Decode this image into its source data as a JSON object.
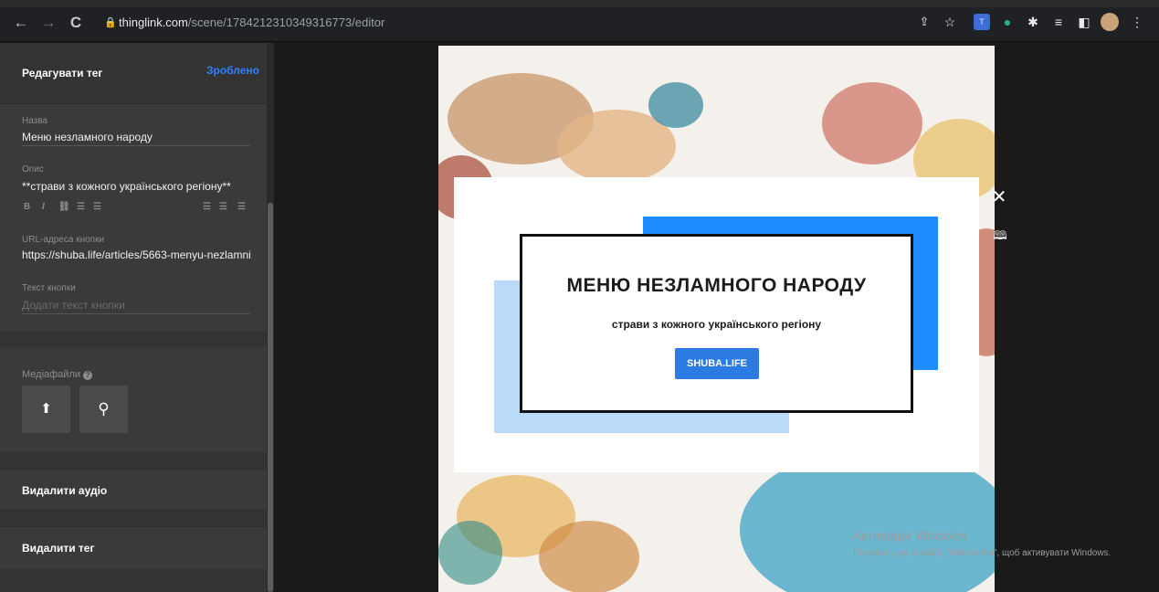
{
  "browser": {
    "url_host": "thinglink.com",
    "url_path": "/scene/1784212310349316773/editor",
    "back": "←",
    "forward": "→",
    "reload": "C"
  },
  "panel": {
    "title": "Редагувати тег",
    "done_label": "Зроблено",
    "fields": {
      "name_label": "Назва",
      "name_value": "Меню незламного народу",
      "desc_label": "Опис",
      "desc_value": "**страви з кожного українського регіону**",
      "url_label": "URL-адреса кнопки",
      "url_value": "https://shuba.life/articles/5663-menyu-nezlamni",
      "btn_text_label": "Текст кнопки",
      "btn_text_placeholder": "Додати текст кнопки"
    },
    "format_toolbar": [
      "B",
      "I",
      "🔗",
      "≡",
      "≡",
      "≣",
      "≣",
      "≣"
    ],
    "media": {
      "label": "Медіафайли",
      "upload_glyph": "⬆",
      "search_glyph": "⚲"
    },
    "actions": {
      "remove_audio": "Видалити аудіо",
      "remove_tag": "Видалити тег"
    }
  },
  "tag_card": {
    "title": "МЕНЮ НЕЗЛАМНОГО НАРОДУ",
    "subtitle": "страви з кожного українського регіону",
    "button": "SHUBA.LIFE",
    "accent_blue": "#1e8bff",
    "light_blue": "#b9daf9"
  },
  "windows_watermark": {
    "title": "Активація Windows",
    "hint": "Перейдіть до розділу \"Настройки\", щоб активувати Windows."
  }
}
